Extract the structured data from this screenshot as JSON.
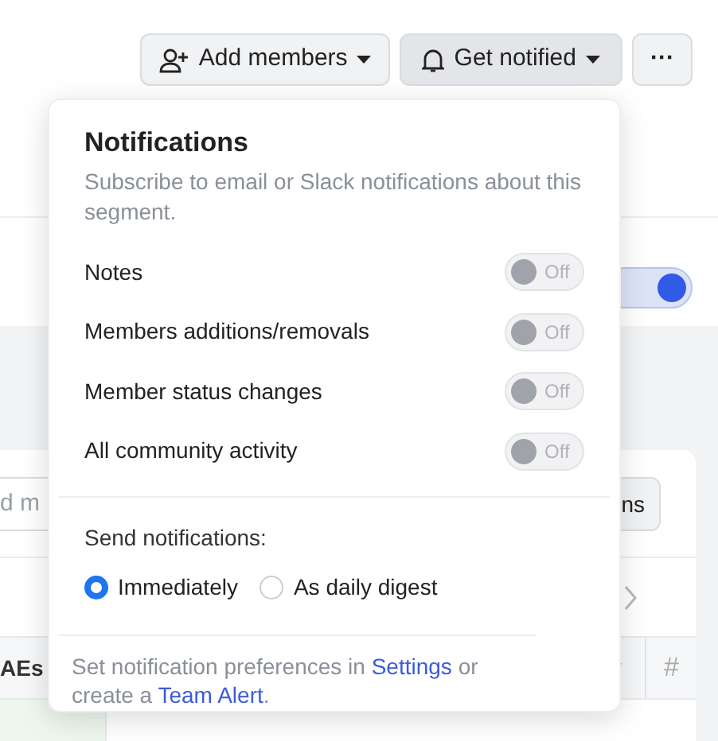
{
  "header": {
    "buttons": [
      {
        "kind": "add",
        "label": "Add members"
      },
      {
        "kind": "notify",
        "label": "Get notified",
        "selected": true
      },
      {
        "kind": "more",
        "label": "···"
      }
    ]
  },
  "background": {
    "toggle_on": true,
    "search_field": {
      "placeholder": "d m"
    },
    "button": "ns",
    "table": {
      "columns": [
        {
          "label": "AEs"
        },
        {
          "label": "#"
        }
      ]
    }
  },
  "popover": {
    "title": "Notifications",
    "description": "Subscribe to email or Slack notifications about this segment.",
    "toggles": [
      {
        "label": "Notes",
        "on": false,
        "state_label": "Off"
      },
      {
        "label": "Members additions/removals",
        "on": false,
        "state_label": "Off"
      },
      {
        "label": "Member status changes",
        "on": false,
        "state_label": "Off"
      },
      {
        "label": "All community activity",
        "on": false,
        "state_label": "Off"
      }
    ],
    "send_label": "Send notifications:",
    "options": [
      {
        "label": "Immediately",
        "selected": true
      },
      {
        "label": "As daily digest",
        "selected": false
      }
    ],
    "footer": [
      {
        "kind": "text",
        "text": "Set notification preferences in"
      },
      {
        "kind": "link",
        "text": "Settings"
      },
      {
        "kind": "text",
        "text": "or create a"
      },
      {
        "kind": "link",
        "text": "Team Alert"
      },
      {
        "kind": "text",
        "text": "."
      }
    ]
  }
}
